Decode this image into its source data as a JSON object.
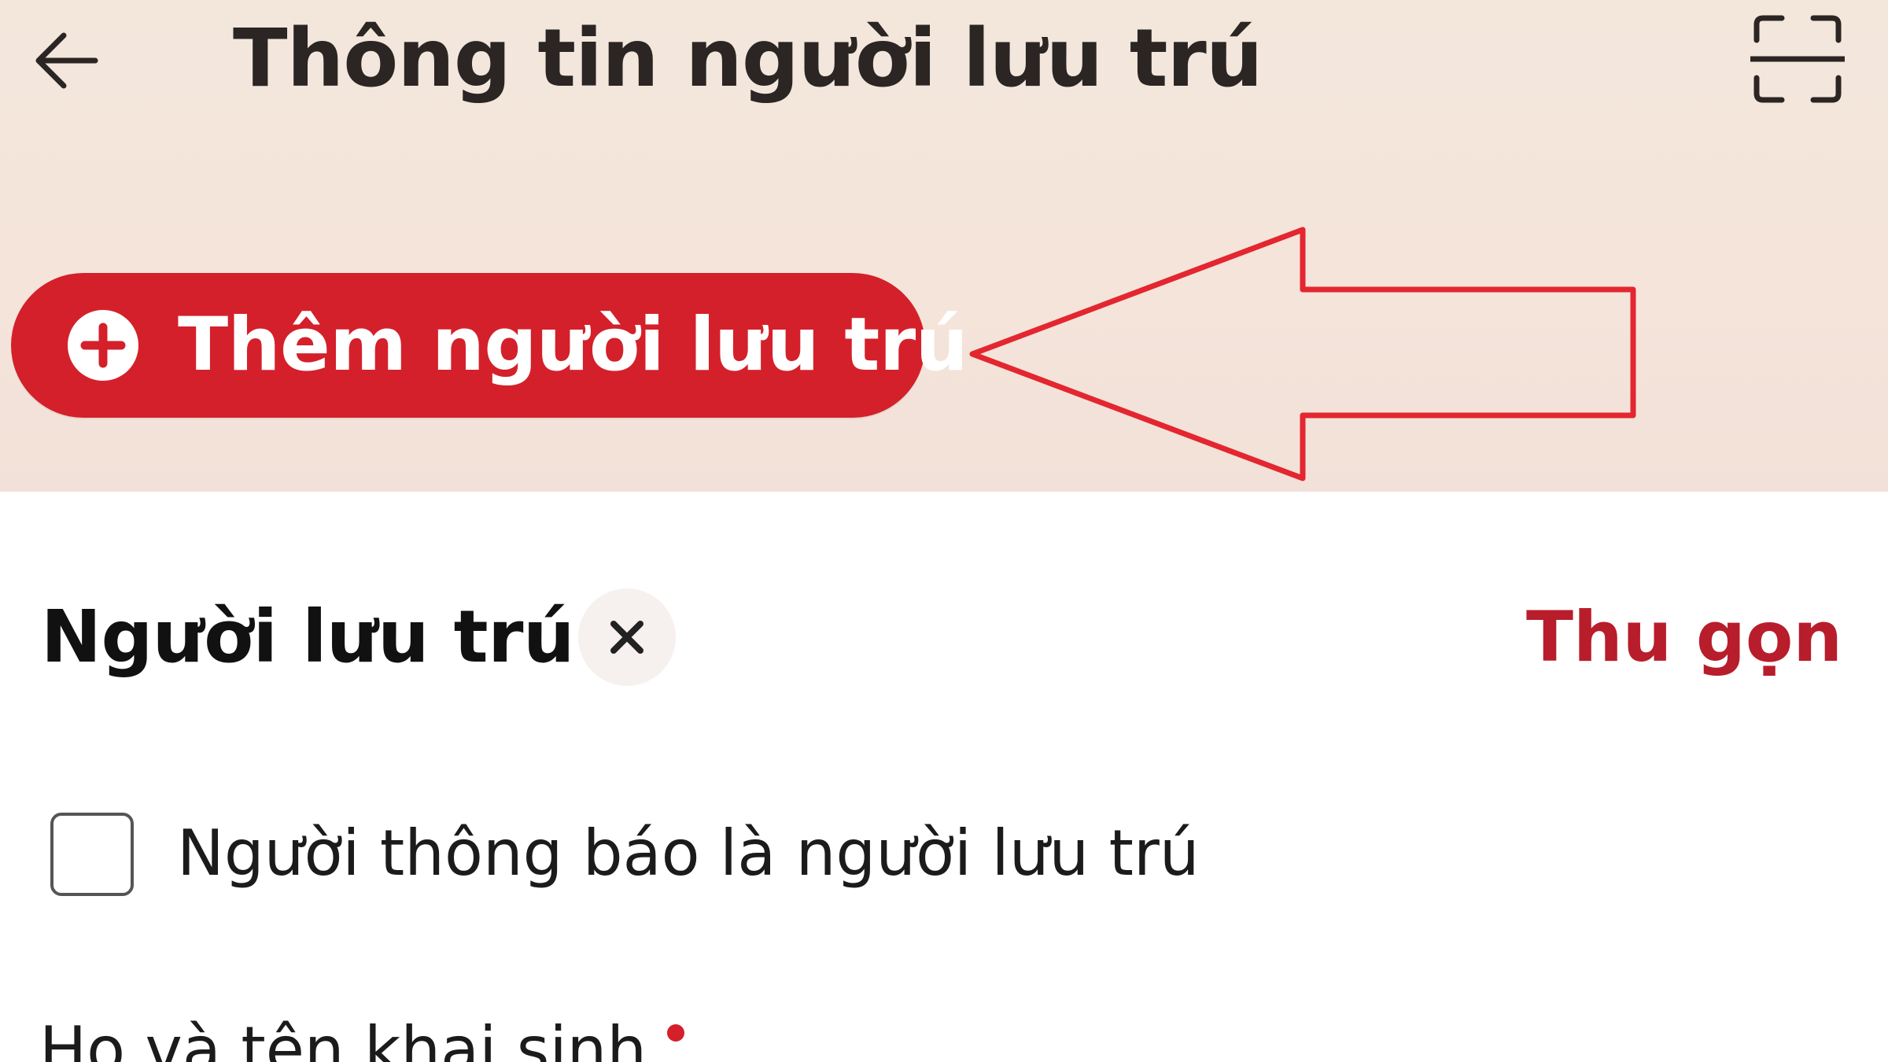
{
  "header": {
    "title": "Thông tin người lưu trú",
    "back_icon": "arrow-left-icon",
    "scan_icon": "scan-frame-icon"
  },
  "add_button": {
    "label": "Thêm người lưu trú",
    "icon": "plus-circle-icon"
  },
  "annotation": {
    "arrow_icon": "arrow-left-outline-icon",
    "color": "#e32630"
  },
  "resident_section": {
    "title": "Người lưu trú",
    "remove_icon": "close-icon",
    "collapse_label": "Thu gọn",
    "checkbox_label": "Người thông báo là người lưu trú",
    "checkbox_checked": false,
    "field_label": "Họ và tên khai sinh"
  },
  "colors": {
    "header_background": "#f3e5db",
    "accent": "#d4202a",
    "link": "#b81d2b"
  }
}
